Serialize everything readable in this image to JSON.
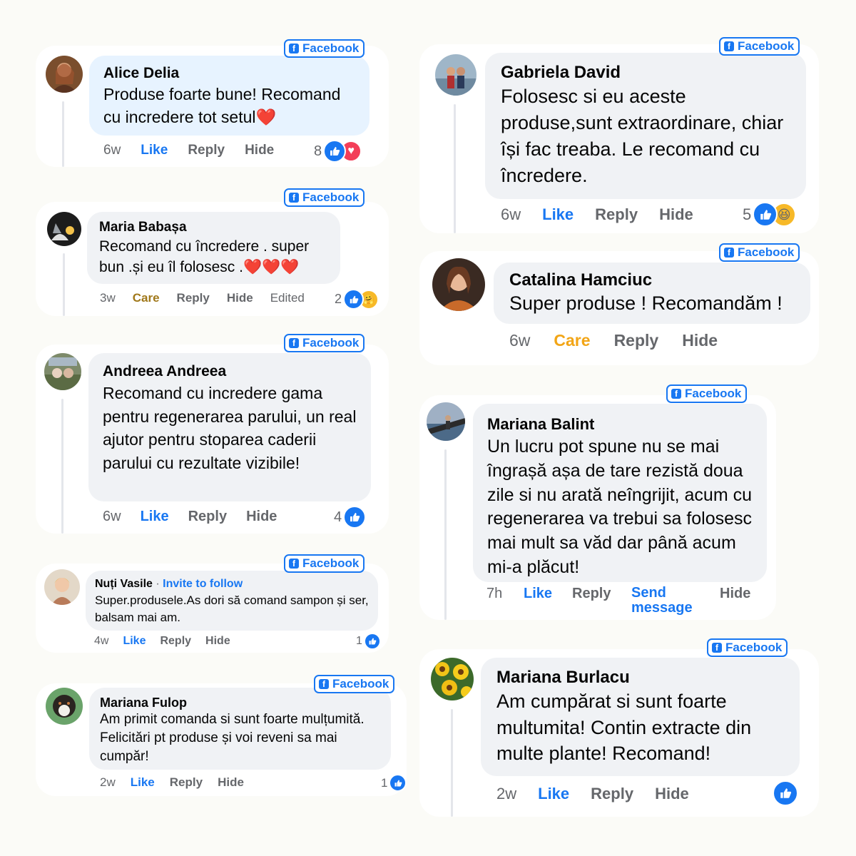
{
  "badge_label": "Facebook",
  "colors": {
    "facebook_blue": "#1877f2",
    "bubble_gray": "#f0f2f5",
    "bubble_blue": "#e7f3ff",
    "care_yellow": "#f2a516",
    "meta_gray": "#65676b"
  },
  "comments": [
    {
      "name": "Alice Delia",
      "text": "Produse foarte bune! Recomand cu incredere tot setul❤️",
      "time": "6w",
      "reaction_action": "Like",
      "reply": "Reply",
      "hide": "Hide",
      "reaction_count": "8",
      "reaction_icons": [
        "like-icon",
        "heart-icon"
      ]
    },
    {
      "name": "Maria Babașa",
      "text": "Recomand cu încredere . super bun .și eu îl folosesc .❤️❤️❤️",
      "time": "3w",
      "reaction_action": "Care",
      "reply": "Reply",
      "hide": "Hide",
      "edited": "Edited",
      "reaction_count": "2",
      "reaction_icons": [
        "like-icon",
        "care-icon"
      ]
    },
    {
      "name": "Andreea Andreea",
      "text": "Recomand cu incredere gama pentru regenerarea parului, un real ajutor pentru stoparea caderii parului cu rezultate vizibile!",
      "time": "6w",
      "reaction_action": "Like",
      "reply": "Reply",
      "hide": "Hide",
      "reaction_count": "4",
      "reaction_icons": [
        "like-icon"
      ]
    },
    {
      "name": "Nuți Vasile",
      "invite": "Invite to follow",
      "separator": " · ",
      "text": "Super.produsele.As dori să comand sampon și ser, balsam mai am.",
      "time": "4w",
      "reaction_action": "Like",
      "reply": "Reply",
      "hide": "Hide",
      "reaction_count": "1",
      "reaction_icons": [
        "like-icon"
      ]
    },
    {
      "name": "Mariana Fulop",
      "text": "Am primit comanda si sunt foarte mulțumită. Felicitări pt produse și voi reveni sa mai cumpăr!",
      "time": "2w",
      "reaction_action": "Like",
      "reply": "Reply",
      "hide": "Hide",
      "reaction_count": "1",
      "reaction_icons": [
        "like-icon"
      ]
    },
    {
      "name": "Gabriela David",
      "text": "Folosesc si eu aceste produse,sunt extraordinare, chiar își fac treaba. Le recomand cu încredere.",
      "time": "6w",
      "reaction_action": "Like",
      "reply": "Reply",
      "hide": "Hide",
      "reaction_count": "5",
      "reaction_icons": [
        "like-icon",
        "haha-icon"
      ]
    },
    {
      "name": "Catalina Hamciuc",
      "text": "Super produse ! Recomandăm !",
      "time": "6w",
      "reaction_action": "Care",
      "reply": "Reply",
      "hide": "Hide"
    },
    {
      "name": "Mariana Balint",
      "text": "Un lucru pot spune nu se mai îngrașă așa de tare rezistă doua zile si nu arată neîngrijit, acum cu regenerarea va trebui sa folosesc mai mult sa văd dar până acum mi-a plăcut!",
      "time": "7h",
      "reaction_action": "Like",
      "reply": "Reply",
      "send_message": "Send message",
      "hide": "Hide"
    },
    {
      "name": "Mariana Burlacu",
      "text": "Am cumpărat si sunt foarte multumita! Contin extracte din multe plante! Recomand!",
      "time": "2w",
      "reaction_action": "Like",
      "reply": "Reply",
      "hide": "Hide",
      "reaction_icons": [
        "like-icon"
      ]
    }
  ]
}
